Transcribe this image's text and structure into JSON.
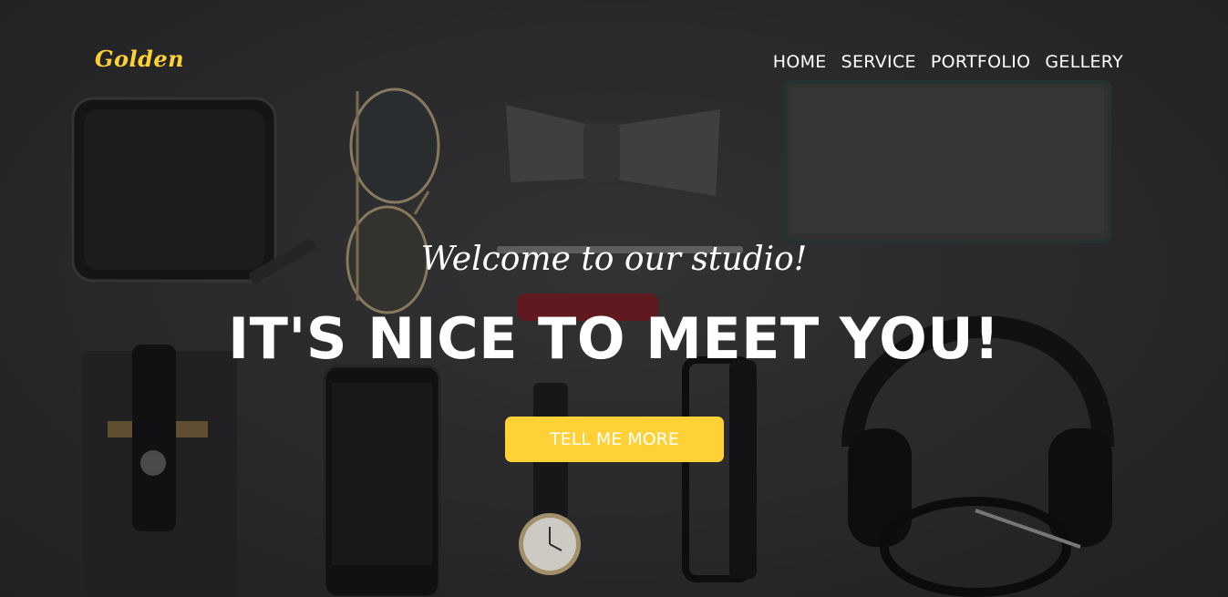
{
  "brand": {
    "logo_text": "Golden",
    "accent_color": "#fed136"
  },
  "nav": {
    "items": [
      {
        "label": "HOME"
      },
      {
        "label": "SERVICE"
      },
      {
        "label": "PORTFOLIO"
      },
      {
        "label": "GELLERY"
      }
    ]
  },
  "hero": {
    "subheading": "Welcome to our studio!",
    "heading": "IT'S NICE TO MEET YOU!",
    "cta_label": "TELL ME MORE",
    "background_image": "flat-lay-accessories-photo"
  }
}
